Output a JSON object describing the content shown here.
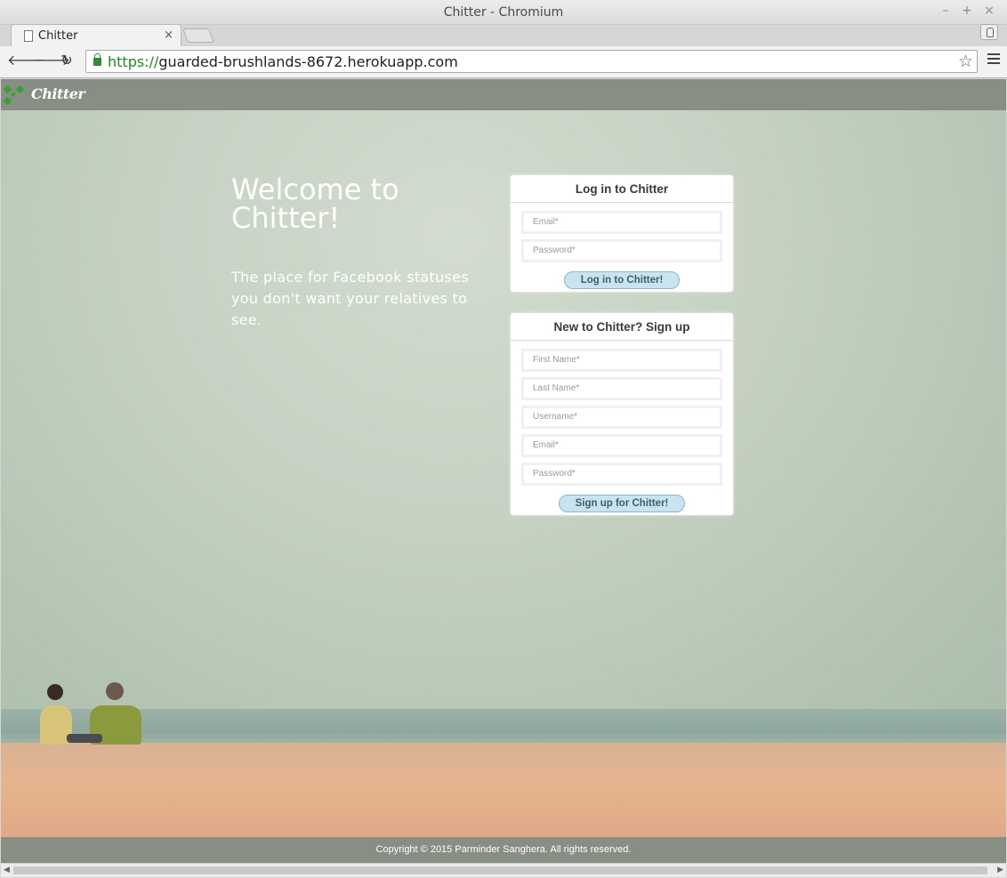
{
  "window": {
    "title": "Chitter - Chromium",
    "controls": {
      "minimize": "–",
      "maximize": "+",
      "close": "×"
    }
  },
  "tab": {
    "title": "Chitter",
    "close": "×"
  },
  "toolbar": {
    "back": "🡐",
    "forward": "🡒",
    "reload": "↻",
    "url_scheme": "https://",
    "url_rest": "guarded-brushlands-8672.herokuapp.com",
    "star": "☆"
  },
  "site": {
    "brand": "Chitter",
    "welcome_title": "Welcome to Chitter!",
    "tagline": "The place for Facebook statuses you don't want your relatives to see.",
    "footer": "Copyright © 2015 Parminder Sanghera. All rights reserved."
  },
  "login": {
    "heading": "Log in to Chitter",
    "email_placeholder": "Email*",
    "password_placeholder": "Password*",
    "button": "Log in to Chitter!"
  },
  "signup": {
    "heading": "New to Chitter? Sign up",
    "first_name_placeholder": "First Name*",
    "last_name_placeholder": "Last Name*",
    "username_placeholder": "Username*",
    "email_placeholder": "Email*",
    "password_placeholder": "Password*",
    "button": "Sign up for Chitter!"
  },
  "colors": {
    "navbar": "#898e85",
    "button_bg": "#c9e3ef",
    "logo_green": "#3aa036",
    "url_scheme": "#1e8a1e"
  }
}
